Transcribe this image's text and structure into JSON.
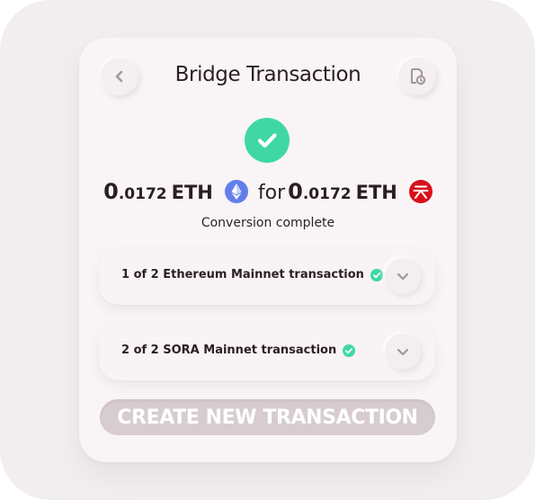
{
  "header": {
    "title": "Bridge Transaction",
    "back_icon": "chevron-left-icon",
    "history_icon": "history-icon"
  },
  "result": {
    "status_icon": "check-circle-icon",
    "from_int": "0",
    "from_dec": ".0172",
    "from_symbol": "ETH",
    "from_token_icon": "ethereum-icon",
    "connector": "for",
    "to_int": "0",
    "to_dec": ".0172",
    "to_symbol": "ETH",
    "to_token_icon": "sora-icon",
    "status_text": "Conversion complete"
  },
  "transactions": [
    {
      "label": "1 of 2 Ethereum Mainnet transaction",
      "status": "complete",
      "expand_icon": "chevron-down-icon"
    },
    {
      "label": "2 of 2 SORA Mainnet transaction",
      "status": "complete",
      "expand_icon": "chevron-down-icon"
    }
  ],
  "actions": {
    "create_label": "CREATE NEW TRANSACTION"
  },
  "colors": {
    "success": "#3fd8a4",
    "ethereum": "#627eea",
    "sora": "#d80f1b",
    "text": "#2b1f22",
    "button_disabled": "#d7cccf"
  }
}
